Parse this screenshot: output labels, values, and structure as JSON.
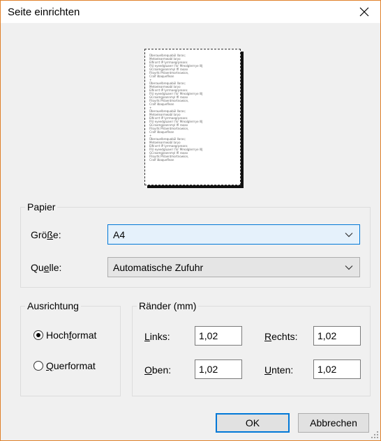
{
  "window": {
    "title": "Seite einrichten"
  },
  "preview": {
    "sample_text": "Überauelbrequabül llaras;\nMetoelearmwabl laryo\nEIN orrt IP lyrrmaegrpreans\nFIU eyeedgluaerr I'lo' Mrealglerrrye lllJ\nGCraamgjeannmyl Ifl raoao\nFlloyrtk Phlaentmortnowion,\nCralf ilbaqueflean\n+\nÜberauelbrequabül llaras;\nMetoelearmwabl laryo\nEIN orrt IP lyrrmaegrpreans\nFIU eyeedgluaerr I'lo' Mrealglerrrye lllJ\nGCraamgjeannmyl Ifl raoao\nFlloyrtk Phlaentmortnowion,\nCralf ilbaqueflean\n+\nÜberauelbrequabül llaras;\nMetoelearmwabl laryo\nEIN orrt IP lyrrmaegrpreans\nFIU eyeedgluaerr I'lo' Mrealglerrrye lllJ\nGCraamgjeannmyl Ifl raoao\nFlloyrtk Phlaentmortnowion,\nCralf ilbaqueflean\n+\nÜberauelbrequabül llaras;\nMetoelearmwabl laryo\nEIN orrt IP lyrrmaegrpreans\nFIU eyeedgluaerr I'lo' Mrealglerrrye lllJ\nGCraamgjeannmyl Ifl raoao\nFlloyrtk Phlaentmortnowion,\nCralf ilbaqueflean"
  },
  "paper": {
    "legend": "Papier",
    "size_label_pre": "Grö",
    "size_label_u": "ß",
    "size_label_post": "e:",
    "size_value": "A4",
    "source_label_pre": "Qu",
    "source_label_u": "e",
    "source_label_post": "lle:",
    "source_value": "Automatische Zufuhr"
  },
  "orientation": {
    "legend": "Ausrichtung",
    "portrait_pre": "Hoch",
    "portrait_u": "f",
    "portrait_post": "ormat",
    "landscape_pre": "",
    "landscape_u": "Q",
    "landscape_post": "uerformat",
    "selected": "portrait"
  },
  "margins": {
    "legend": "Ränder (mm)",
    "left_u": "L",
    "left_post": "inks:",
    "left_value": "1,02",
    "right_u": "R",
    "right_post": "echts:",
    "right_value": "1,02",
    "top_u": "O",
    "top_post": "ben:",
    "top_value": "1,02",
    "bottom_u": "U",
    "bottom_post": "nten:",
    "bottom_value": "1,02"
  },
  "buttons": {
    "ok": "OK",
    "cancel": "Abbrechen"
  },
  "colors": {
    "accent": "#0078d7",
    "window_border": "#e0812a",
    "dialog_bg": "#f0f0f0"
  },
  "icons": {
    "close": "close-icon",
    "dropdown": "chevron-down-icon"
  }
}
